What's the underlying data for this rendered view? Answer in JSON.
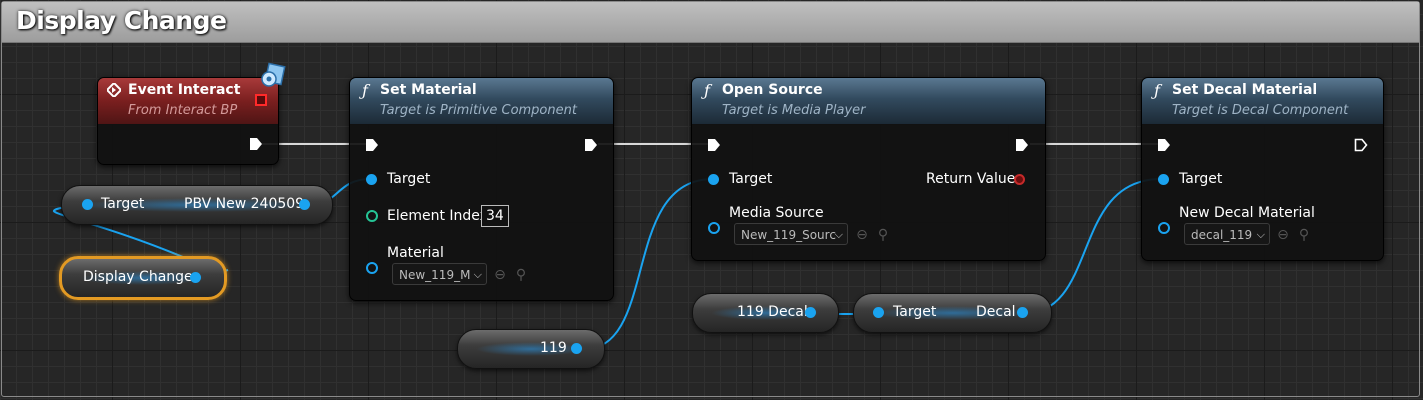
{
  "comment": {
    "title": "Display Change"
  },
  "colors": {
    "object_pin": "#1aa3f0",
    "int_pin": "#25c495",
    "header_function": "#324a5e",
    "header_event": "#7a1f1f",
    "selected_outline": "#e39a23"
  },
  "event_node": {
    "title": "Event Interact",
    "subtitle": "From Interact BP",
    "icon": "event-diamond-icon"
  },
  "set_material": {
    "title": "Set Material",
    "subtitle": "Target is Primitive Component",
    "pin_target": "Target",
    "pin_element_index": "Element Index",
    "element_index_value": "34",
    "pin_material": "Material",
    "material_value": "New_119_M"
  },
  "open_source": {
    "title": "Open Source",
    "subtitle": "Target is Media Player",
    "pin_target": "Target",
    "pin_return": "Return Value",
    "pin_media_source": "Media Source",
    "media_source_value": "New_119_Sourc"
  },
  "set_decal_material": {
    "title": "Set Decal Material",
    "subtitle": "Target is Decal Component",
    "pin_target": "Target",
    "pin_new_decal_material": "New Decal Material",
    "decal_value": "decal_119"
  },
  "vars": {
    "target_left": "Target",
    "target_right": "PBV New 240509",
    "display_change": "Display Change",
    "v119": "119",
    "v119_decal": "119 Decal",
    "get_target": "Target",
    "get_decal": "Decal"
  }
}
